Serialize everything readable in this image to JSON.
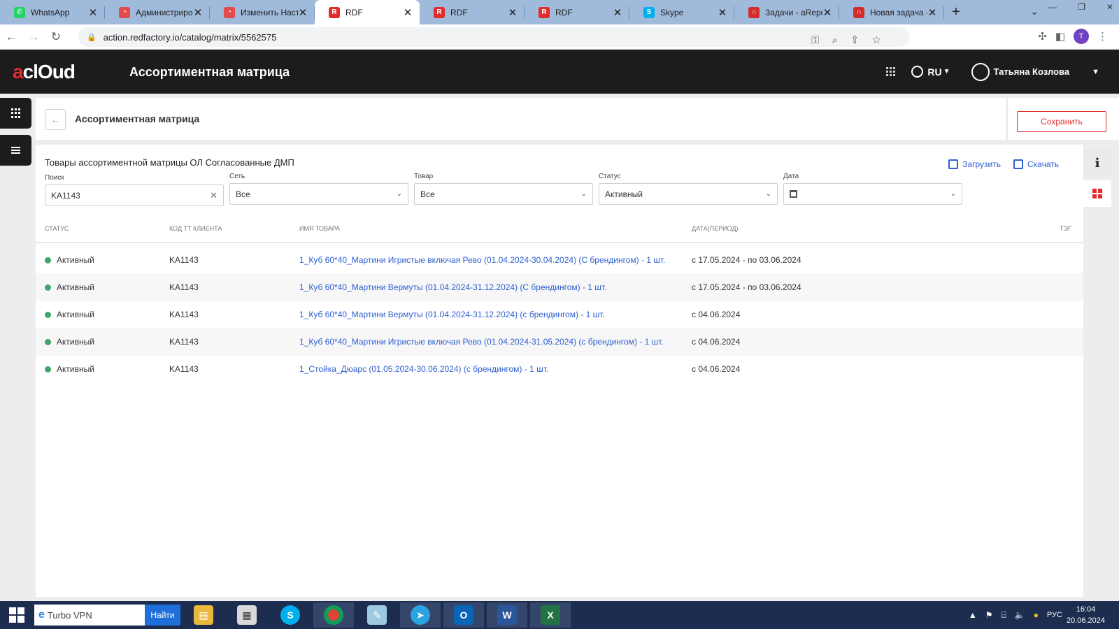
{
  "browser": {
    "tabs": [
      {
        "title": "WhatsApp",
        "fav_color": "#25d366",
        "fav_glyph": "✆",
        "active": false
      },
      {
        "title": "Администрирование",
        "fav_color": "#e34a4a",
        "fav_glyph": "◔",
        "active": false
      },
      {
        "title": "Изменить Настройки",
        "fav_color": "#e34a4a",
        "fav_glyph": "◔",
        "active": false
      },
      {
        "title": "RDF",
        "fav_color": "#e32b2b",
        "fav_glyph": "R",
        "active": true
      },
      {
        "title": "RDF",
        "fav_color": "#e32b2b",
        "fav_glyph": "R",
        "active": false
      },
      {
        "title": "RDF",
        "fav_color": "#e32b2b",
        "fav_glyph": "R",
        "active": false
      },
      {
        "title": "Skype",
        "fav_color": "#00aff0",
        "fav_glyph": "S",
        "active": false
      },
      {
        "title": "Задачи - aReport",
        "fav_color": "#d42b2b",
        "fav_glyph": "∩",
        "active": false
      },
      {
        "title": "Новая задача - aReport",
        "fav_color": "#d42b2b",
        "fav_glyph": "∩",
        "active": false
      }
    ],
    "url": "action.redfactory.io/catalog/matrix/5562575",
    "profile_initial": "T"
  },
  "app": {
    "logo_a": "a",
    "logo_rest": "clOud",
    "title": "Ассортиментная матрица",
    "lang": "RU",
    "user_name": "Татьяна Козлова"
  },
  "page": {
    "title": "Ассортиментная матрица",
    "save_label": "Сохранить"
  },
  "main": {
    "title": "Товары ассортиментной матрицы ОЛ Согласованные ДМП",
    "upload_label": "Загрузить",
    "download_label": "Скачать",
    "filters": {
      "search_label": "Поиск",
      "search_value": "KA1143",
      "network_label": "Сеть",
      "network_value": "Все",
      "product_label": "Товар",
      "product_value": "Все",
      "status_label": "Статус",
      "status_value": "Активный",
      "date_label": "Дата"
    },
    "columns": {
      "status": "Статус",
      "code": "Код ТТ клиента",
      "name": "Имя товара",
      "date": "Дата(период)",
      "tag": "Тэг"
    },
    "rows": [
      {
        "status": "Активный",
        "code": "KA1143",
        "name": "1_Куб 60*40_Мартини Игристые включая Рево (01.04.2024-30.04.2024) (С брендингом) - 1 шт.",
        "date": "с 17.05.2024 - по 03.06.2024"
      },
      {
        "status": "Активный",
        "code": "KA1143",
        "name": "1_Куб 60*40_Мартини Вермуты (01.04.2024-31.12.2024) (С брендингом) - 1 шт.",
        "date": "с 17.05.2024 - по 03.06.2024"
      },
      {
        "status": "Активный",
        "code": "KA1143",
        "name": "1_Куб 60*40_Мартини Вермуты (01.04.2024-31.12.2024) (с брендингом) - 1 шт.",
        "date": "с 04.06.2024"
      },
      {
        "status": "Активный",
        "code": "KA1143",
        "name": "1_Куб 60*40_Мартини Игристые включая Рево (01.04.2024-31.05.2024) (с брендингом) - 1 шт.",
        "date": "с 04.06.2024"
      },
      {
        "status": "Активный",
        "code": "KA1143",
        "name": "1_Стойка_Дюарс (01.05.2024-30.06.2024) (с брендингом) - 1 шт.",
        "date": "с 04.06.2024"
      }
    ]
  },
  "taskbar": {
    "search_value": "Turbo VPN",
    "find_label": "Найти",
    "lang": "РУС",
    "time": "16:04",
    "date": "20.06.2024"
  },
  "colors": {
    "accent": "#e32b2b",
    "link": "#2d5fd1",
    "status_active": "#3fa56b",
    "header_bg": "#1d1b1c"
  }
}
